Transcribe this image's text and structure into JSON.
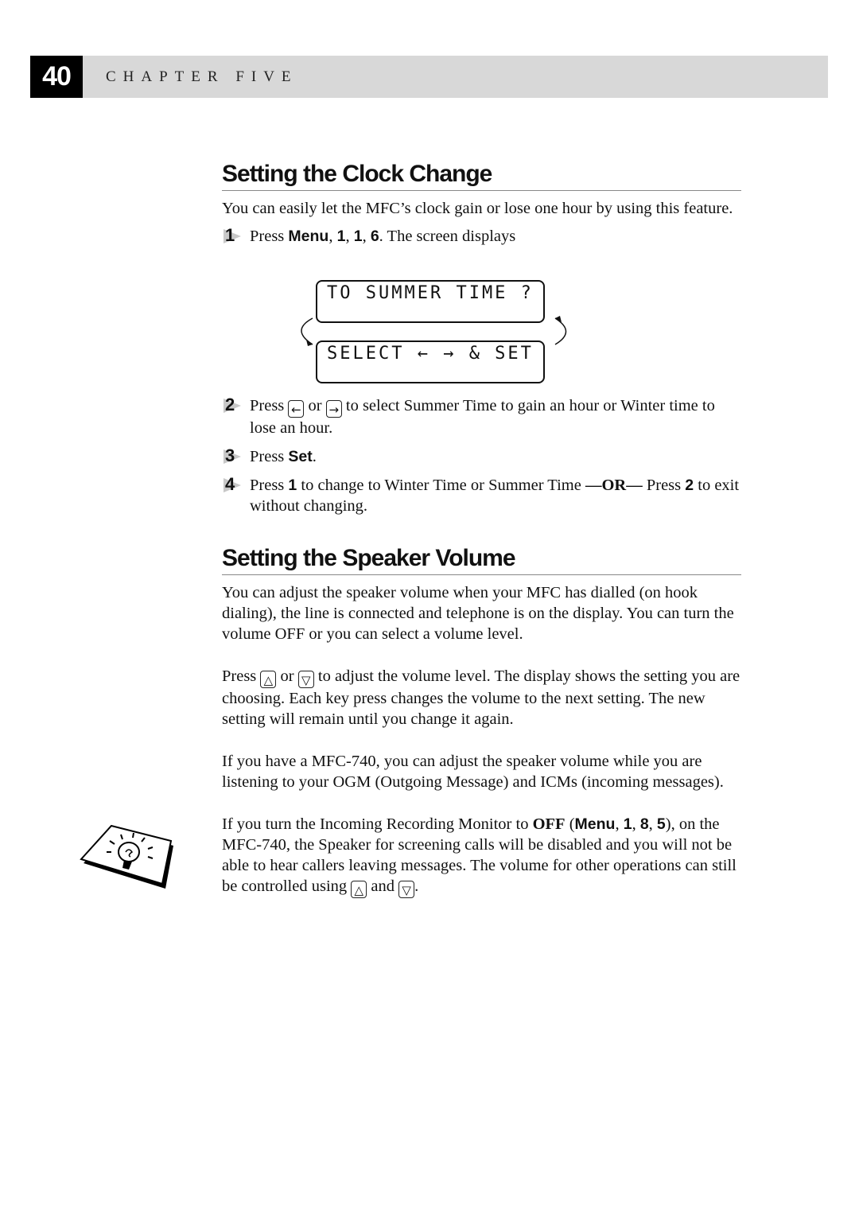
{
  "header": {
    "page_number": "40",
    "chapter": "CHAPTER FIVE"
  },
  "section1": {
    "title": "Setting the Clock Change",
    "intro": "You can easily let the MFC’s clock gain or lose one hour by using this feature.",
    "steps": [
      {
        "num": "1",
        "pre": "Press ",
        "keys": "Menu",
        "mid1": ", ",
        "k1": "1",
        "mid2": ", ",
        "k2": "1",
        "mid3": ", ",
        "k3": "6",
        "post": ". The screen displays"
      },
      {
        "num": "2",
        "pre": "Press ",
        "left_key": "←",
        "or": " or ",
        "right_key": "→",
        "post": " to select Summer Time to gain an hour or Winter time to lose an hour."
      },
      {
        "num": "3",
        "pre": "Press ",
        "key": "Set",
        "post": "."
      },
      {
        "num": "4",
        "pre": "Press ",
        "k1": "1",
        "mid": " to change to Winter Time or Summer Time ",
        "or": "—OR—",
        "mid2": " Press ",
        "k2": "2",
        "post": " to exit without changing."
      }
    ],
    "lcd": {
      "line1": "TO SUMMER TIME ?",
      "line2": "SELECT ← → & SET"
    }
  },
  "section2": {
    "title": "Setting the Speaker Volume",
    "p1": "You can adjust the speaker volume when your MFC has dialled (on hook dialing), the line is connected and telephone is on the display. You can turn the volume OFF or you can select a volume level.",
    "p2_pre": "Press ",
    "up_key": "△",
    "p2_or": " or ",
    "down_key": "▽",
    "p2_post": " to adjust the volume level. The display shows the setting you are choosing. Each key press changes the volume to the next setting. The new setting will remain until you change it again.",
    "p3": "If you have a MFC-740, you can adjust the speaker volume while you are listening to your OGM (Outgoing Message) and ICMs (incoming messages).",
    "note": {
      "pre": "If you turn the Incoming Recording Monitor to ",
      "off": "OFF",
      "paren_open": " (",
      "menu": "Menu",
      "c1": ", ",
      "k1": "1",
      "c2": ", ",
      "k2": "8",
      "c3": ", ",
      "k3": "5",
      "mid": "), on the MFC-740, the Speaker for screening calls will be disabled and you will not be able to hear callers leaving messages. The volume for other operations can still be controlled using ",
      "and": " and ",
      "end": "."
    }
  }
}
